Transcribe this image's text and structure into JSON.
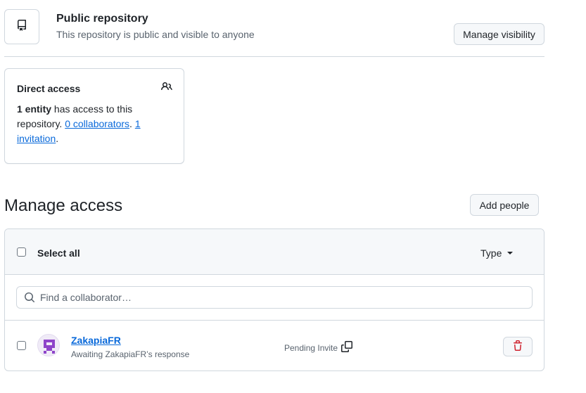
{
  "visibility": {
    "title": "Public repository",
    "description": "This repository is public and visible to anyone",
    "manage_button": "Manage visibility",
    "icon": "repo-icon"
  },
  "direct_access": {
    "title": "Direct access",
    "icon": "people-icon",
    "entity_count": "1 entity",
    "text_mid": " has access to this repository. ",
    "collaborators_link": "0 collaborators",
    "separator": ". ",
    "invitation_link": "1 invitation",
    "text_end": "."
  },
  "manage_access": {
    "heading": "Manage access",
    "add_button": "Add people",
    "select_all": "Select all",
    "type_filter": "Type",
    "search": {
      "placeholder": "Find a collaborator…",
      "value": ""
    },
    "members": [
      {
        "name": "ZakapiaFR",
        "subtitle": "Awaiting ZakapiaFR’s response",
        "status": "Pending Invite",
        "status_icon": "copy-icon",
        "action_icon": "trash-icon"
      }
    ]
  },
  "colors": {
    "link": "#0969da",
    "danger": "#cf222e",
    "avatar_accent": "#8e44c9",
    "border": "#d0d7de",
    "header_bg": "#f6f8fa"
  }
}
